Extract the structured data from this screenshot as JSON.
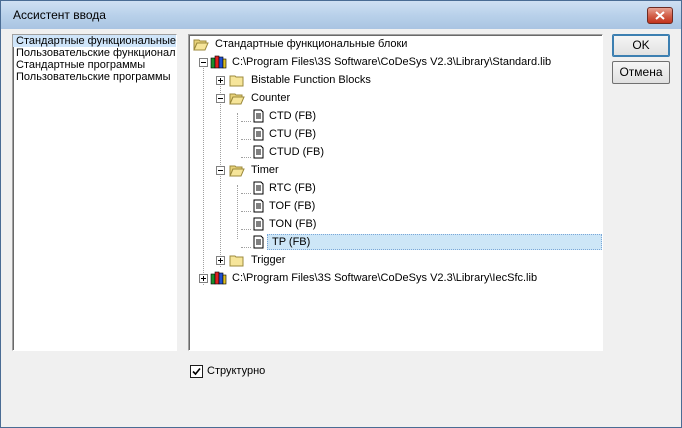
{
  "window": {
    "title": "Ассистент ввода"
  },
  "categories": [
    {
      "label": "Стандартные функциональные блоки",
      "selected": true
    },
    {
      "label": "Пользовательские функциональные блоки",
      "selected": false
    },
    {
      "label": "Стандартные программы",
      "selected": false
    },
    {
      "label": "Пользовательские программы",
      "selected": false
    }
  ],
  "tree": {
    "root": "Стандартные функциональные блоки",
    "lib1": "C:\\Program Files\\3S Software\\CoDeSys V2.3\\Library\\Standard.lib",
    "bistable": "Bistable Function Blocks",
    "counter": "Counter",
    "ctd": "CTD (FB)",
    "ctu": "CTU (FB)",
    "ctud": "CTUD (FB)",
    "timer": "Timer",
    "rtc": "RTC (FB)",
    "tof": "TOF (FB)",
    "ton": "TON (FB)",
    "tp": "TP (FB)",
    "trigger": "Trigger",
    "lib2": "C:\\Program Files\\3S Software\\CoDeSys V2.3\\Library\\IecSfc.lib"
  },
  "buttons": {
    "ok": "OK",
    "cancel": "Отмена"
  },
  "structured": {
    "label": "Структурно",
    "checked": true
  }
}
